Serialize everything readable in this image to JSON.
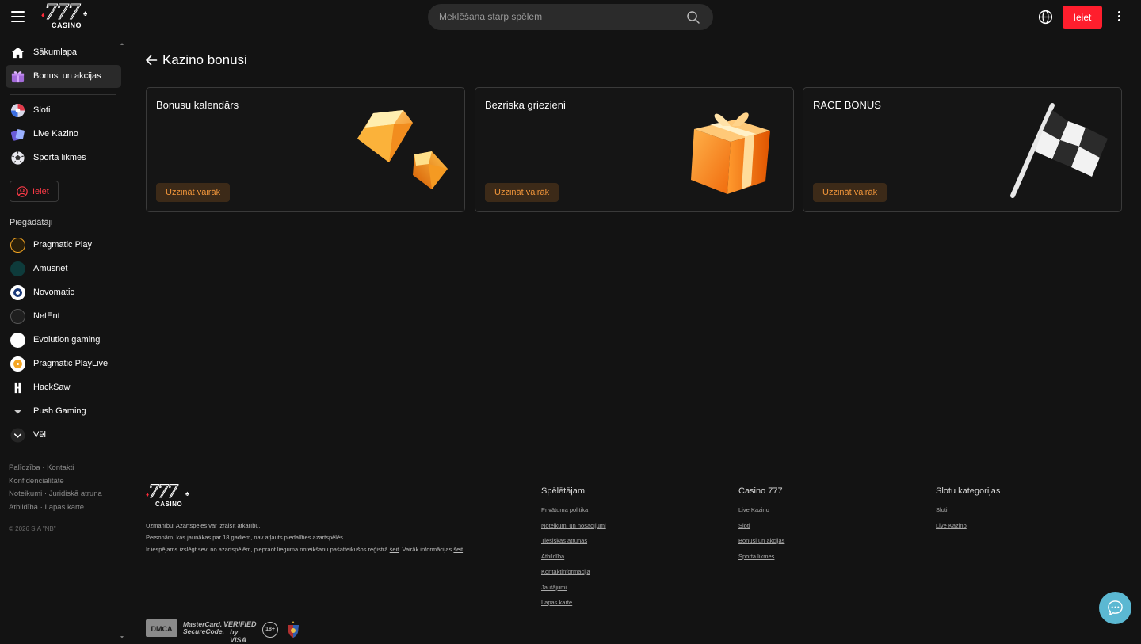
{
  "header": {
    "logo": {
      "digits": "777",
      "sub": "CASINO"
    },
    "search_placeholder": "Meklēšana starp spēlem",
    "login_label": "Ieiet"
  },
  "sidebar": {
    "top_items": [
      {
        "label": "Sākumlapa",
        "icon": "home-icon"
      },
      {
        "label": "Bonusi un akcijas",
        "icon": "gift-icon",
        "active": true
      }
    ],
    "game_items": [
      {
        "label": "Sloti",
        "icon": "slots-icon"
      },
      {
        "label": "Live Kazino",
        "icon": "live-casino-icon"
      },
      {
        "label": "Sporta likmes",
        "icon": "football-icon"
      }
    ],
    "login_label": "Ieiet",
    "providers_title": "Piegādātāji",
    "providers": [
      {
        "label": "Pragmatic Play",
        "color": "#2a1f0a"
      },
      {
        "label": "Amusnet",
        "color": "#0e3b3b"
      },
      {
        "label": "Novomatic",
        "color": "#ffffff"
      },
      {
        "label": "NetEnt",
        "color": "#1f1f1f"
      },
      {
        "label": "Evolution gaming",
        "color": "#ffffff"
      },
      {
        "label": "Pragmatic PlayLive",
        "color": "#ffffff"
      },
      {
        "label": "HackSaw",
        "color": "#111111"
      },
      {
        "label": "Push Gaming",
        "color": "#1a1a1a"
      }
    ],
    "more_label": "Vēl",
    "footer_links": {
      "row1": [
        "Palīdzība",
        "Kontakti"
      ],
      "row2": [
        "Konfidencialitāte"
      ],
      "row3": [
        "Noteikumi",
        "Juridiskā atruna"
      ],
      "row4": [
        "Atbildība",
        "Lapas karte"
      ]
    },
    "copyright": "© 2026 SIA \"NB\""
  },
  "main": {
    "title": "Kazino bonusi",
    "cards": [
      {
        "title": "Bonusu kalendārs",
        "button": "Uzzināt vairāk",
        "art": "diamonds"
      },
      {
        "title": "Bezriska griezieni",
        "button": "Uzzināt vairāk",
        "art": "gift-box"
      },
      {
        "title": "RACE BONUS",
        "button": "Uzzināt vairāk",
        "art": "checkered-flag"
      }
    ]
  },
  "footer": {
    "warning_line1": "Uzmanību! Azartspēles var izraisīt atkarību.",
    "warning_line2": "Personām, kas jaunākas par 18 gadiem, nav atļauts piedalīties azartspēlēs.",
    "warning_line3_a": "Ir iespējams izslēgt sevi no azartspēlēm, piepraot lieguma noteikšanu pašatteikušos reģistrā ",
    "warning_line3_link1": "šeit",
    "warning_line3_b": ". Vairāk informācijas ",
    "warning_line3_link2": "šeit",
    "warning_line3_c": ".",
    "columns": [
      {
        "title": "Spēlētājam",
        "links": [
          "Privātuma politika",
          "Noteikumi un nosacījumi",
          "Tiesiskās atrunas",
          "Atbildība",
          "Kontaktinformācija",
          "Jautājumi",
          "Lapas karte"
        ]
      },
      {
        "title": "Casino 777",
        "links": [
          "Live Kazino",
          "Sloti",
          "Bonusi un akcijas",
          "Sporta likmes"
        ]
      },
      {
        "title": "Slotu kategorijas",
        "links": [
          "Sloti",
          "Live Kazino"
        ]
      }
    ],
    "badges": {
      "dmca": "DMCA",
      "mastercard_1": "MasterCard.",
      "mastercard_2": "SecureCode.",
      "visa_1": "VERIFIED",
      "visa_2": "by VISA",
      "age": "18+"
    }
  },
  "colors": {
    "accent": "#ff1e2d",
    "card_button_bg": "#3c2a18",
    "card_button_text": "#f0953a",
    "chat": "#5bb8d2"
  }
}
